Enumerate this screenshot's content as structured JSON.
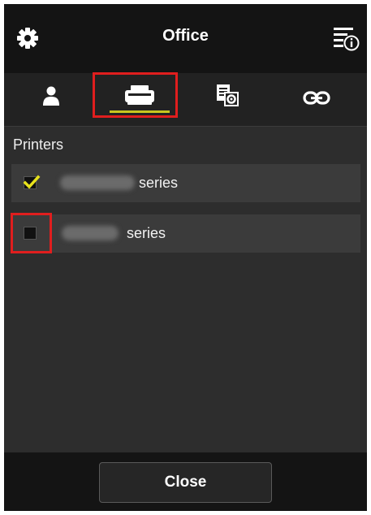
{
  "header": {
    "title": "Office",
    "left_icon": "gear-icon",
    "right_icon": "menu-info-icon"
  },
  "tabs": [
    {
      "icon": "person-icon",
      "selected": false
    },
    {
      "icon": "printer-icon",
      "selected": true
    },
    {
      "icon": "document-settings-icon",
      "selected": false
    },
    {
      "icon": "link-icon",
      "selected": false
    }
  ],
  "printers_section": {
    "label": "Printers",
    "items": [
      {
        "name_suffix": "series",
        "checked": true
      },
      {
        "name_suffix": "series",
        "checked": false
      }
    ]
  },
  "footer": {
    "close_label": "Close"
  },
  "colors": {
    "accent_underline": "#c9c51f",
    "check_mark": "#e8e21c",
    "highlight_box": "#e01e1e"
  }
}
